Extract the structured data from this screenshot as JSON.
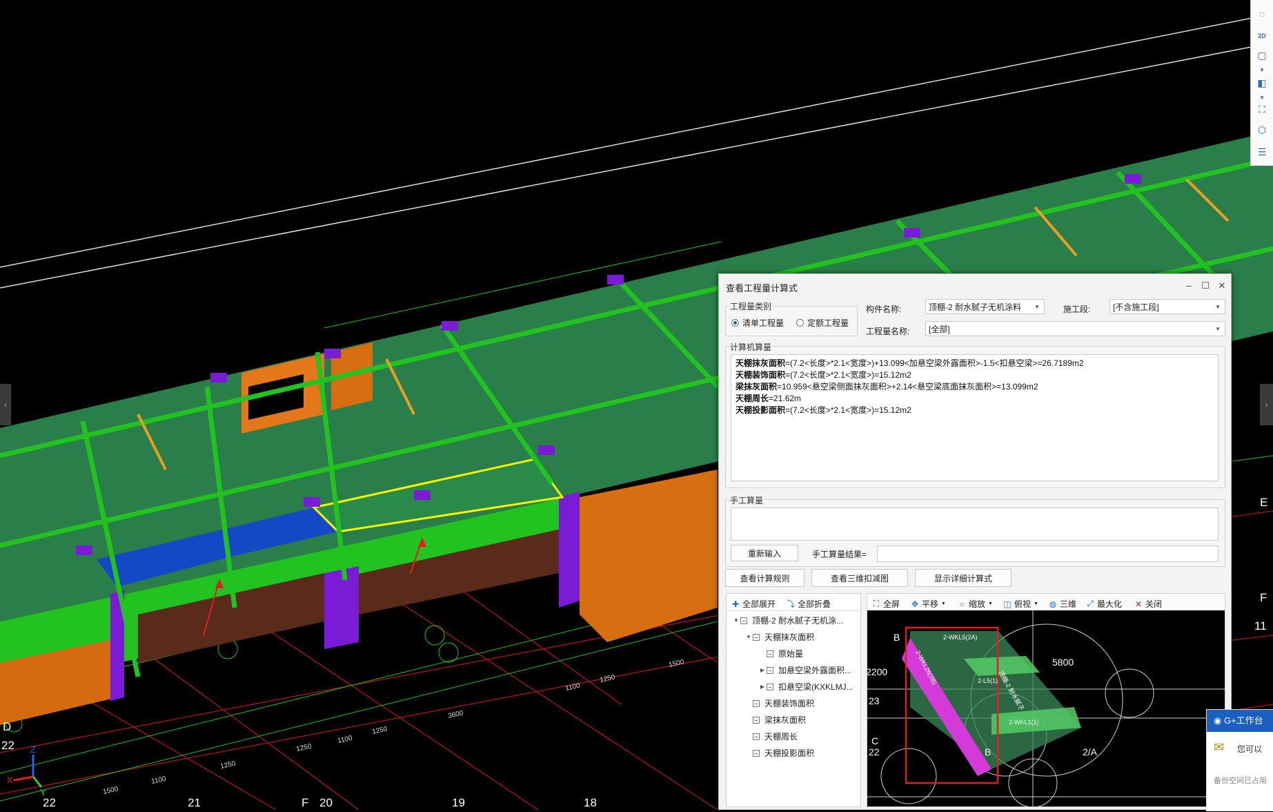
{
  "cad": {
    "axis_labels_bottom": [
      "22",
      "21",
      "F",
      "20",
      "19",
      "18"
    ],
    "axis_labels_left": [
      "D",
      "22"
    ],
    "axis_labels_right": [
      "E",
      "F",
      "11"
    ],
    "dims_bottom": [
      "1500",
      "1100",
      "1250",
      "1250",
      "1100",
      "1250",
      "3600",
      "1100",
      "1250",
      "1500"
    ],
    "view_labels": [
      "C",
      "22",
      "23",
      "B",
      "B",
      "2/A",
      "2200",
      "5800"
    ],
    "axis_x": "X",
    "axis_y": "Y",
    "axis_z": "Z",
    "preview_labels": [
      "2-WKL5(2A)",
      "2-L5(1)",
      "2-WKL1(1)",
      "顶棚-2 耐水腻子",
      "2-WKL26(2B)"
    ],
    "colors": {
      "bg": "#000000",
      "slab": "#2f8a52",
      "beam": "#27c91a",
      "column": "#7a1bd6",
      "wall": "#e07a12",
      "selected": "#1450c8",
      "highlight": "#ffff00"
    }
  },
  "rightbar": {
    "icons": [
      "orbit-icon",
      "2d-icon",
      "box-view-icon",
      "chevron-down-icon",
      "cube-icon",
      "chevron-down-icon",
      "fullscreen-icon",
      "layer-cube-icon",
      "list-settings-icon"
    ],
    "label_2d": "2D"
  },
  "dialog": {
    "title": "查看工程量计算式",
    "qty_type_label": "工程量类别",
    "radio_bill": "清单工程量",
    "radio_quota": "定额工程量",
    "component_label": "构件名称:",
    "component_value": "顶棚-2 耐水腻子无机涂料",
    "stage_label": "施工段:",
    "stage_value": "[不含施工段]",
    "qty_name_label": "工程量名称:",
    "qty_name_value": "[全部]",
    "computer_label": "计算机算量",
    "formulas": [
      {
        "name": "天棚抹灰面积",
        "expr": "=(7.2<长度>*2.1<宽度>)+13.099<加悬空梁外露面积>-1.5<扣悬空梁>=26.7189m2"
      },
      {
        "name": "天棚装饰面积",
        "expr": "=(7.2<长度>*2.1<宽度>)=15.12m2"
      },
      {
        "name": "梁抹灰面积",
        "expr": "=10.959<悬空梁侧面抹灰面积>+2.14<悬空梁底面抹灰面积>=13.099m2"
      },
      {
        "name": "天棚周长",
        "expr": "=21.62m"
      },
      {
        "name": "天棚投影面积",
        "expr": "=(7.2<长度>*2.1<宽度>)=15.12m2"
      }
    ],
    "manual_label": "手工算量",
    "reenter_button": "重新输入",
    "manual_result_label": "手工算量结果=",
    "buttons": {
      "rules": "查看计算规则",
      "view3d": "查看三维扣减图",
      "detail": "显示详细计算式"
    },
    "tree_toolbar": {
      "expand": "全部展开",
      "collapse": "全部折叠"
    },
    "view_toolbar": {
      "fullscreen": "全屏",
      "pan": "平移",
      "zoom": "缩放",
      "top": "俯视",
      "three_d": "三维",
      "maximize": "最大化",
      "close": "关闭"
    },
    "tree": [
      {
        "label": "顶棚-2 耐水腻子无机涂...",
        "level": 0,
        "toggle": "▼"
      },
      {
        "label": "天棚抹灰面积",
        "level": 1,
        "toggle": "▼"
      },
      {
        "label": "原始量",
        "level": 2,
        "toggle": ""
      },
      {
        "label": "加悬空梁外露面积...",
        "level": 2,
        "toggle": "▶"
      },
      {
        "label": "扣悬空梁(KXKLMJ...",
        "level": 2,
        "toggle": "▶"
      },
      {
        "label": "天棚装饰面积",
        "level": 1,
        "toggle": ""
      },
      {
        "label": "梁抹灰面积",
        "level": 1,
        "toggle": ""
      },
      {
        "label": "天棚周长",
        "level": 1,
        "toggle": ""
      },
      {
        "label": "天棚投影面积",
        "level": 1,
        "toggle": ""
      }
    ]
  },
  "gwork": {
    "title": "G+工作台",
    "line1": "您可以",
    "line2": "备份空间已占用"
  }
}
